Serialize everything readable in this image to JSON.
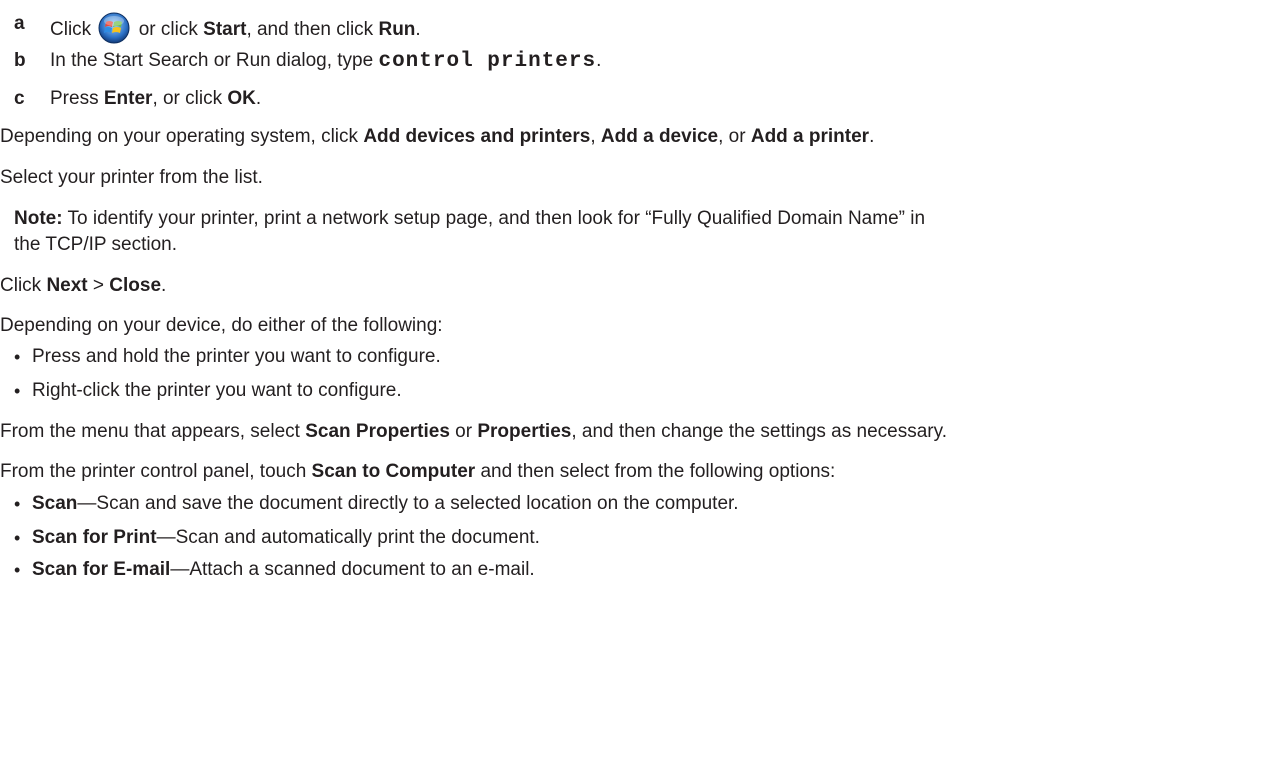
{
  "steps_substeps": [
    {
      "letter": "a",
      "pre": "Click",
      "icon": "windows-start-orb-icon",
      "mid1": " or click ",
      "bold1": "Start",
      "mid2": ", and then click ",
      "bold2": "Run",
      "end": "."
    },
    {
      "letter": "b",
      "pre": "In the Start Search or Run dialog, type ",
      "code": "control printers",
      "end": "."
    },
    {
      "letter": "c",
      "pre": "Press ",
      "bold1": "Enter",
      "mid1": ", or click ",
      "bold2": "OK",
      "end": "."
    }
  ],
  "para_add": {
    "pre": "Depending on your operating system, click ",
    "b1": "Add devices and printers",
    "s1": ", ",
    "b2": "Add a device",
    "s2": ", or ",
    "b3": "Add a printer",
    "end": "."
  },
  "para_select": "Select your printer from the list.",
  "note": {
    "label": "Note:",
    "line1": " To identify your printer, print a network setup page, and then look for “Fully Qualified Domain Name” in",
    "line2": "the TCP/IP section."
  },
  "para_click": {
    "pre": "Click ",
    "b1": "Next",
    "sep": " > ",
    "b2": "Close",
    "end": "."
  },
  "para_device": "Depending on your device, do either of the following:",
  "device_bullets": [
    "Press and hold the printer you want to configure.",
    "Right-click the printer you want to configure."
  ],
  "para_menu": {
    "pre": "From the menu that appears, select ",
    "b1": "Scan Properties",
    "mid": " or ",
    "b2": "Properties",
    "end": ", and then change the settings as necessary."
  },
  "para_panel": {
    "pre": "From the printer control panel, touch ",
    "b1": "Scan to Computer",
    "end": " and then select from the following options:"
  },
  "scan_options": [
    {
      "name": "Scan",
      "desc": "—Scan and save the document directly to a selected location on the computer."
    },
    {
      "name": "Scan for Print",
      "desc": "—Scan and automatically print the document."
    },
    {
      "name": "Scan for E-mail",
      "desc": "—Attach a scanned document to an e-mail."
    }
  ],
  "bullet_glyph": "•"
}
